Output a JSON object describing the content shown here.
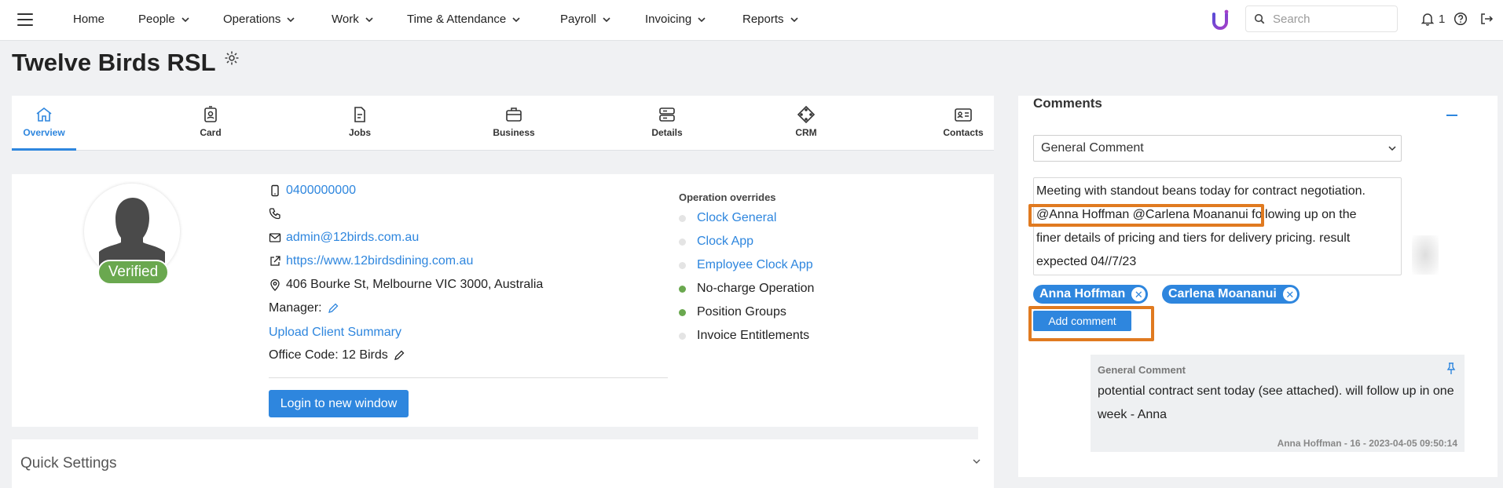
{
  "nav": {
    "items": [
      {
        "label": "Home",
        "dropdown": false
      },
      {
        "label": "People",
        "dropdown": true
      },
      {
        "label": "Operations",
        "dropdown": true
      },
      {
        "label": "Work",
        "dropdown": true
      },
      {
        "label": "Time & Attendance",
        "dropdown": true
      },
      {
        "label": "Payroll",
        "dropdown": true
      },
      {
        "label": "Invoicing",
        "dropdown": true
      },
      {
        "label": "Reports",
        "dropdown": true
      }
    ],
    "search_placeholder": "Search",
    "notification_count": "1"
  },
  "page": {
    "title": "Twelve Birds RSL"
  },
  "tabs": [
    {
      "label": "Overview",
      "icon": "home-icon",
      "active": true
    },
    {
      "label": "Card",
      "icon": "id-badge-icon",
      "active": false
    },
    {
      "label": "Jobs",
      "icon": "document-icon",
      "active": false
    },
    {
      "label": "Business",
      "icon": "briefcase-icon",
      "active": false
    },
    {
      "label": "Details",
      "icon": "server-icon",
      "active": false
    },
    {
      "label": "CRM",
      "icon": "network-icon",
      "active": false
    },
    {
      "label": "Contacts",
      "icon": "address-card-icon",
      "active": false
    }
  ],
  "profile": {
    "verified_label": "Verified",
    "mobile": "0400000000",
    "phone": "",
    "email": "admin@12birds.com.au",
    "website": "https://www.12birdsdining.com.au",
    "address": "406 Bourke St, Melbourne VIC 3000, Australia",
    "manager_label": "Manager:",
    "upload_link": "Upload Client Summary",
    "office_code": "Office Code: 12 Birds",
    "login_button": "Login to new window"
  },
  "operation_overrides": {
    "title": "Operation overrides",
    "items": [
      {
        "label": "Clock General",
        "enabled": false,
        "link": true
      },
      {
        "label": "Clock App",
        "enabled": false,
        "link": true
      },
      {
        "label": "Employee Clock App",
        "enabled": false,
        "link": true
      },
      {
        "label": "No-charge Operation",
        "enabled": true,
        "link": false
      },
      {
        "label": "Position Groups",
        "enabled": true,
        "link": false
      },
      {
        "label": "Invoice Entitlements",
        "enabled": false,
        "link": false
      }
    ]
  },
  "quick_settings": {
    "title": "Quick Settings"
  },
  "comments": {
    "title": "Comments",
    "type_selected": "General Comment",
    "text_lines": [
      "Meeting with standout beans today for contract negotiation.",
      "@Anna Hoffman @Carlena Moananui following up on the",
      "finer details of pricing and tiers for delivery pricing. result",
      "expected 04//7/23"
    ],
    "mentions": [
      "Anna Hoffman",
      "Carlena Moananui"
    ],
    "add_button": "Add comment",
    "items": [
      {
        "type": "General Comment",
        "text": "potential contract sent today (see attached). will follow up in one week - Anna",
        "meta": "Anna Hoffman - 16 - 2023-04-05 09:50:14"
      }
    ]
  },
  "colors": {
    "accent": "#2e86de",
    "verified": "#6aa84f",
    "highlight": "#e07a20",
    "enabled_dot": "#6aa84f",
    "disabled_dot": "#e4e4e4"
  }
}
